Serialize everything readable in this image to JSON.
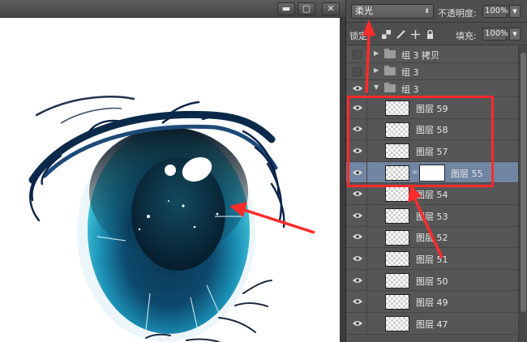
{
  "window": {
    "minimize": "▬",
    "maximize": "▢",
    "close": "✕"
  },
  "options": {
    "blend_mode": "柔光",
    "opacity_label": "不透明度:",
    "opacity_value": "100%",
    "lock_label": "锁定",
    "fill_label": "填充:",
    "fill_value": "100%"
  },
  "layers": [
    {
      "type": "group",
      "name": "组 3 拷贝",
      "visible": false,
      "expanded": false
    },
    {
      "type": "group",
      "name": "组 3",
      "visible": false,
      "expanded": false
    },
    {
      "type": "group",
      "name": "组 3",
      "visible": true,
      "expanded": true
    },
    {
      "type": "layer",
      "name": "图层 59",
      "visible": true
    },
    {
      "type": "layer",
      "name": "图层 58",
      "visible": true
    },
    {
      "type": "layer",
      "name": "图层 57",
      "visible": true
    },
    {
      "type": "layer",
      "name": "图层 55",
      "visible": true,
      "selected": true,
      "mask": true
    },
    {
      "type": "layer",
      "name": "图层 54",
      "visible": true
    },
    {
      "type": "layer",
      "name": "图层 53",
      "visible": true
    },
    {
      "type": "layer",
      "name": "图层 52",
      "visible": true
    },
    {
      "type": "layer",
      "name": "图层 51",
      "visible": true
    },
    {
      "type": "layer",
      "name": "图层 50",
      "visible": true
    },
    {
      "type": "layer",
      "name": "图层 49",
      "visible": true
    },
    {
      "type": "layer",
      "name": "图层 47",
      "visible": true
    }
  ],
  "colors": {
    "annotation": "#ff2b2b",
    "selected_row": "#7086a2",
    "panel": "#535353"
  },
  "icons": [
    "eye-icon",
    "folder-icon",
    "lock-pixels-icon",
    "lock-brush-icon",
    "lock-move-icon",
    "lock-all-icon"
  ]
}
